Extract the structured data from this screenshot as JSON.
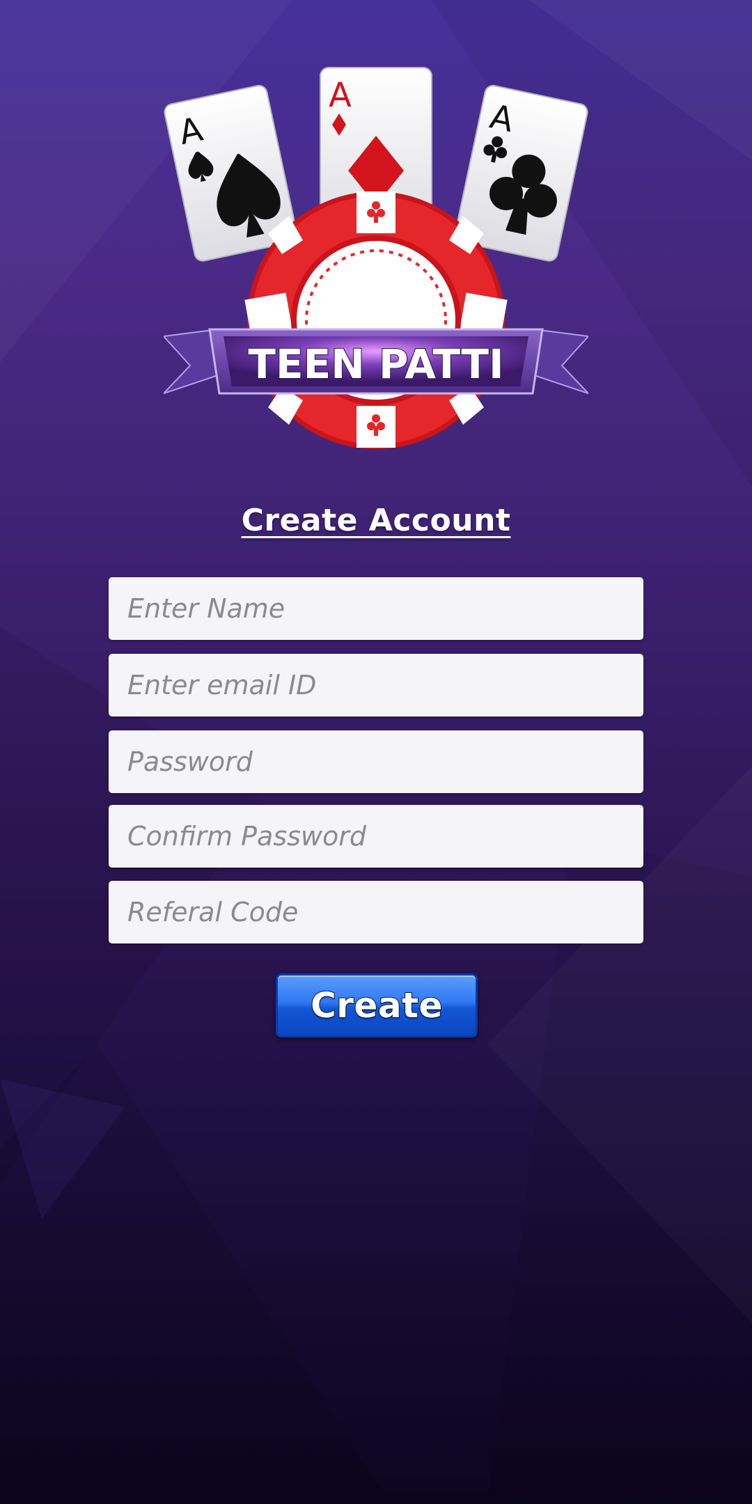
{
  "logo": {
    "banner_text": "TEEN PATTI",
    "card_rank": "A"
  },
  "form": {
    "title": "Create Account",
    "fields": [
      {
        "placeholder": "Enter Name"
      },
      {
        "placeholder": "Enter email ID"
      },
      {
        "placeholder": "Password"
      },
      {
        "placeholder": "Confirm Password"
      },
      {
        "placeholder": "Referal Code"
      }
    ],
    "submit_label": "Create"
  },
  "colors": {
    "background_top": "#46309a",
    "background_bottom": "#0c0520",
    "chip_red": "#e5262b",
    "banner_purple": "#5b2b8f",
    "button_blue": "#1357d6"
  }
}
